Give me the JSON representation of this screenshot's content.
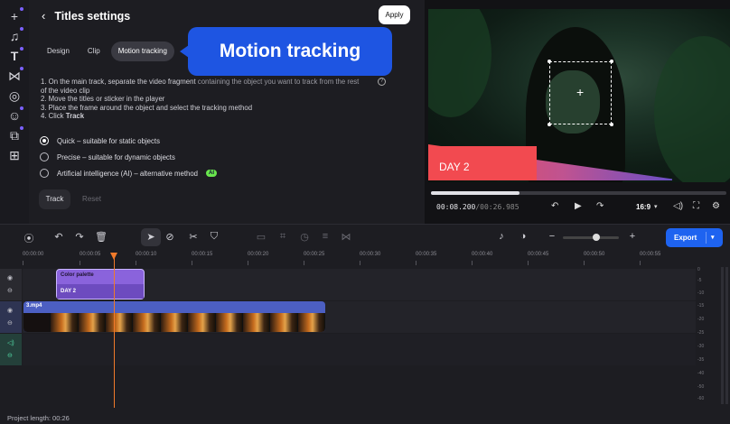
{
  "panel": {
    "title": "Titles settings",
    "apply_label": "Apply",
    "tabs": [
      {
        "label": "Design"
      },
      {
        "label": "Clip"
      },
      {
        "label": "Motion tracking",
        "active": true
      }
    ],
    "callout_text": "Motion tracking",
    "instructions": {
      "step1a": "1. On the main track, separate the video fragment ",
      "step1b": "containing the object you want to track from the rest",
      "step1c": "of the video clip",
      "step2": "2. Move the titles or sticker in the player",
      "step3": "3. Place the frame around the object and select the tracking method",
      "step4_prefix": "4. Click ",
      "step4_bold": "Track"
    },
    "options": [
      {
        "label": "Quick – suitable for static objects",
        "selected": true
      },
      {
        "label": "Precise – suitable for dynamic objects",
        "selected": false
      },
      {
        "label": "Artificial intelligence (AI) – alternative method",
        "selected": false,
        "badge": "AI"
      }
    ],
    "track_label": "Track",
    "reset_label": "Reset"
  },
  "preview": {
    "banner_text": "DAY 2",
    "time_current": "00:08.200",
    "time_total": "/00:26.985",
    "progress_fraction": 0.3,
    "aspect_ratio": "16:9"
  },
  "toolbar": {
    "export_label": "Export",
    "zoom_fraction": 0.6
  },
  "ruler": {
    "ticks": [
      "00:00:00",
      "00:00:05",
      "00:00:10",
      "00:00:15",
      "00:00:20",
      "00:00:25",
      "00:00:30",
      "00:00:35",
      "00:00:40",
      "00:00:45",
      "00:00:50",
      "00:00:55"
    ]
  },
  "tracks": {
    "title_clip": {
      "name": "Color palette",
      "text": "DAY 2"
    },
    "video_clip": {
      "name": "3.mp4"
    }
  },
  "meter_labels": [
    "0",
    "-5",
    "-10",
    "-15",
    "-20",
    "-25",
    "-30",
    "-35",
    "-40",
    "-50",
    "-60"
  ],
  "status": {
    "project_length": "Project length: 00:26"
  },
  "colors": {
    "accent": "#1e63f0",
    "title_clip": "#8a63dc",
    "video_clip": "#4c5fc2",
    "playhead": "#f07a2a",
    "ai_badge": "#69e64d"
  }
}
